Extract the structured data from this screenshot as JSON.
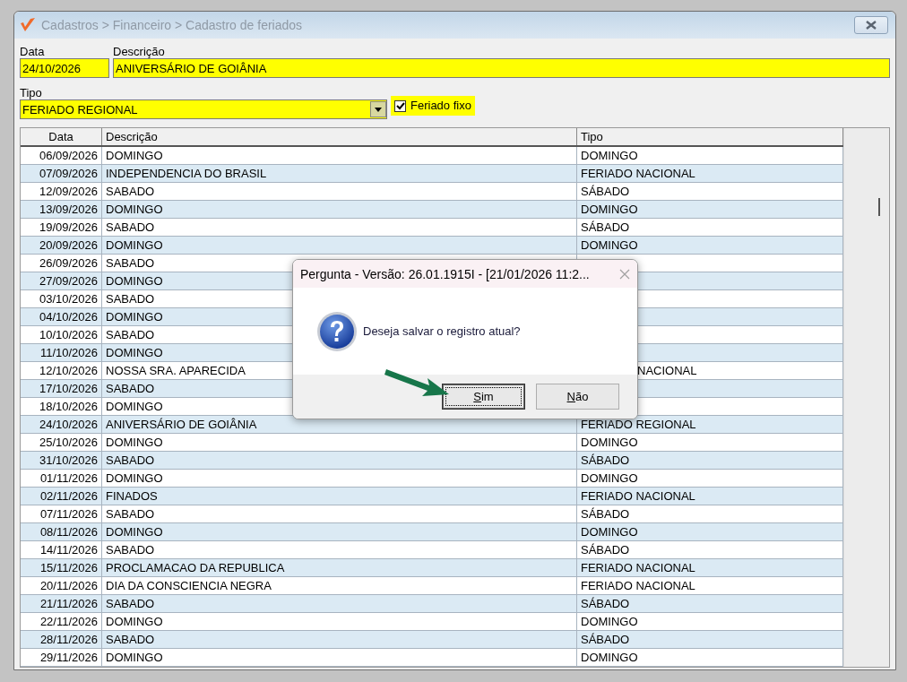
{
  "window": {
    "title": "Cadastros > Financeiro > Cadastro de feriados"
  },
  "form": {
    "fields": [
      {
        "label": "Data",
        "value": "24/10/2026"
      },
      {
        "label": "Descrição",
        "value": "ANIVERSÁRIO DE GOIÂNIA"
      }
    ],
    "tipo": {
      "label": "Tipo",
      "value": "FERIADO REGIONAL"
    },
    "fixed": {
      "label": "Feriado fixo",
      "checked": true
    }
  },
  "table": {
    "columns": [
      "Data",
      "Descrição",
      "Tipo"
    ],
    "rows": [
      {
        "data": "06/09/2026",
        "descricao": "DOMINGO",
        "tipo": "DOMINGO"
      },
      {
        "data": "07/09/2026",
        "descricao": "INDEPENDENCIA DO BRASIL",
        "tipo": "FERIADO NACIONAL"
      },
      {
        "data": "12/09/2026",
        "descricao": "SABADO",
        "tipo": "SÁBADO"
      },
      {
        "data": "13/09/2026",
        "descricao": "DOMINGO",
        "tipo": "DOMINGO"
      },
      {
        "data": "19/09/2026",
        "descricao": "SABADO",
        "tipo": "SÁBADO"
      },
      {
        "data": "20/09/2026",
        "descricao": "DOMINGO",
        "tipo": "DOMINGO"
      },
      {
        "data": "26/09/2026",
        "descricao": "SABADO"
      },
      {
        "data": "27/09/2026",
        "descricao": "DOMINGO"
      },
      {
        "data": "03/10/2026",
        "descricao": "SABADO"
      },
      {
        "data": "04/10/2026",
        "descricao": "DOMINGO"
      },
      {
        "data": "10/10/2026",
        "descricao": "SABADO"
      },
      {
        "data": "11/10/2026",
        "descricao": "DOMINGO"
      },
      {
        "data": "12/10/2026",
        "descricao": "NOSSA SRA. APARECIDA",
        "tipo": "NACIONAL",
        "covered": true
      },
      {
        "data": "17/10/2026",
        "descricao": "SABADO"
      },
      {
        "data": "18/10/2026",
        "descricao": "DOMINGO"
      },
      {
        "data": "24/10/2026",
        "descricao": "ANIVERSÁRIO DE GOIÂNIA",
        "tipo": "FERIADO REGIONAL"
      },
      {
        "data": "25/10/2026",
        "descricao": "DOMINGO",
        "tipo": "DOMINGO"
      },
      {
        "data": "31/10/2026",
        "descricao": "SABADO",
        "tipo": "SÁBADO"
      },
      {
        "data": "01/11/2026",
        "descricao": "DOMINGO",
        "tipo": "DOMINGO"
      },
      {
        "data": "02/11/2026",
        "descricao": "FINADOS",
        "tipo": "FERIADO NACIONAL"
      },
      {
        "data": "07/11/2026",
        "descricao": "SABADO",
        "tipo": "SÁBADO"
      },
      {
        "data": "08/11/2026",
        "descricao": "DOMINGO",
        "tipo": "DOMINGO"
      },
      {
        "data": "14/11/2026",
        "descricao": "SABADO",
        "tipo": "SÁBADO"
      },
      {
        "data": "15/11/2026",
        "descricao": "PROCLAMACAO DA REPUBLICA",
        "tipo": "FERIADO NACIONAL"
      },
      {
        "data": "20/11/2026",
        "descricao": "DIA DA CONSCIENCIA NEGRA",
        "tipo": "FERIADO NACIONAL"
      },
      {
        "data": "21/11/2026",
        "descricao": "SABADO",
        "tipo": "SÁBADO"
      },
      {
        "data": "22/11/2026",
        "descricao": "DOMINGO",
        "tipo": "DOMINGO"
      },
      {
        "data": "28/11/2026",
        "descricao": "SABADO",
        "tipo": "SÁBADO"
      },
      {
        "data": "29/11/2026",
        "descricao": "DOMINGO",
        "tipo": "DOMINGO"
      }
    ]
  },
  "dialog": {
    "title": "Pergunta - Versão: 26.01.1915I - [21/01/2026 11:2...",
    "message": "Deseja salvar o registro atual?",
    "buttons": [
      {
        "label": "Sim",
        "focused": true
      },
      {
        "label": "Não",
        "focused": false
      }
    ]
  }
}
